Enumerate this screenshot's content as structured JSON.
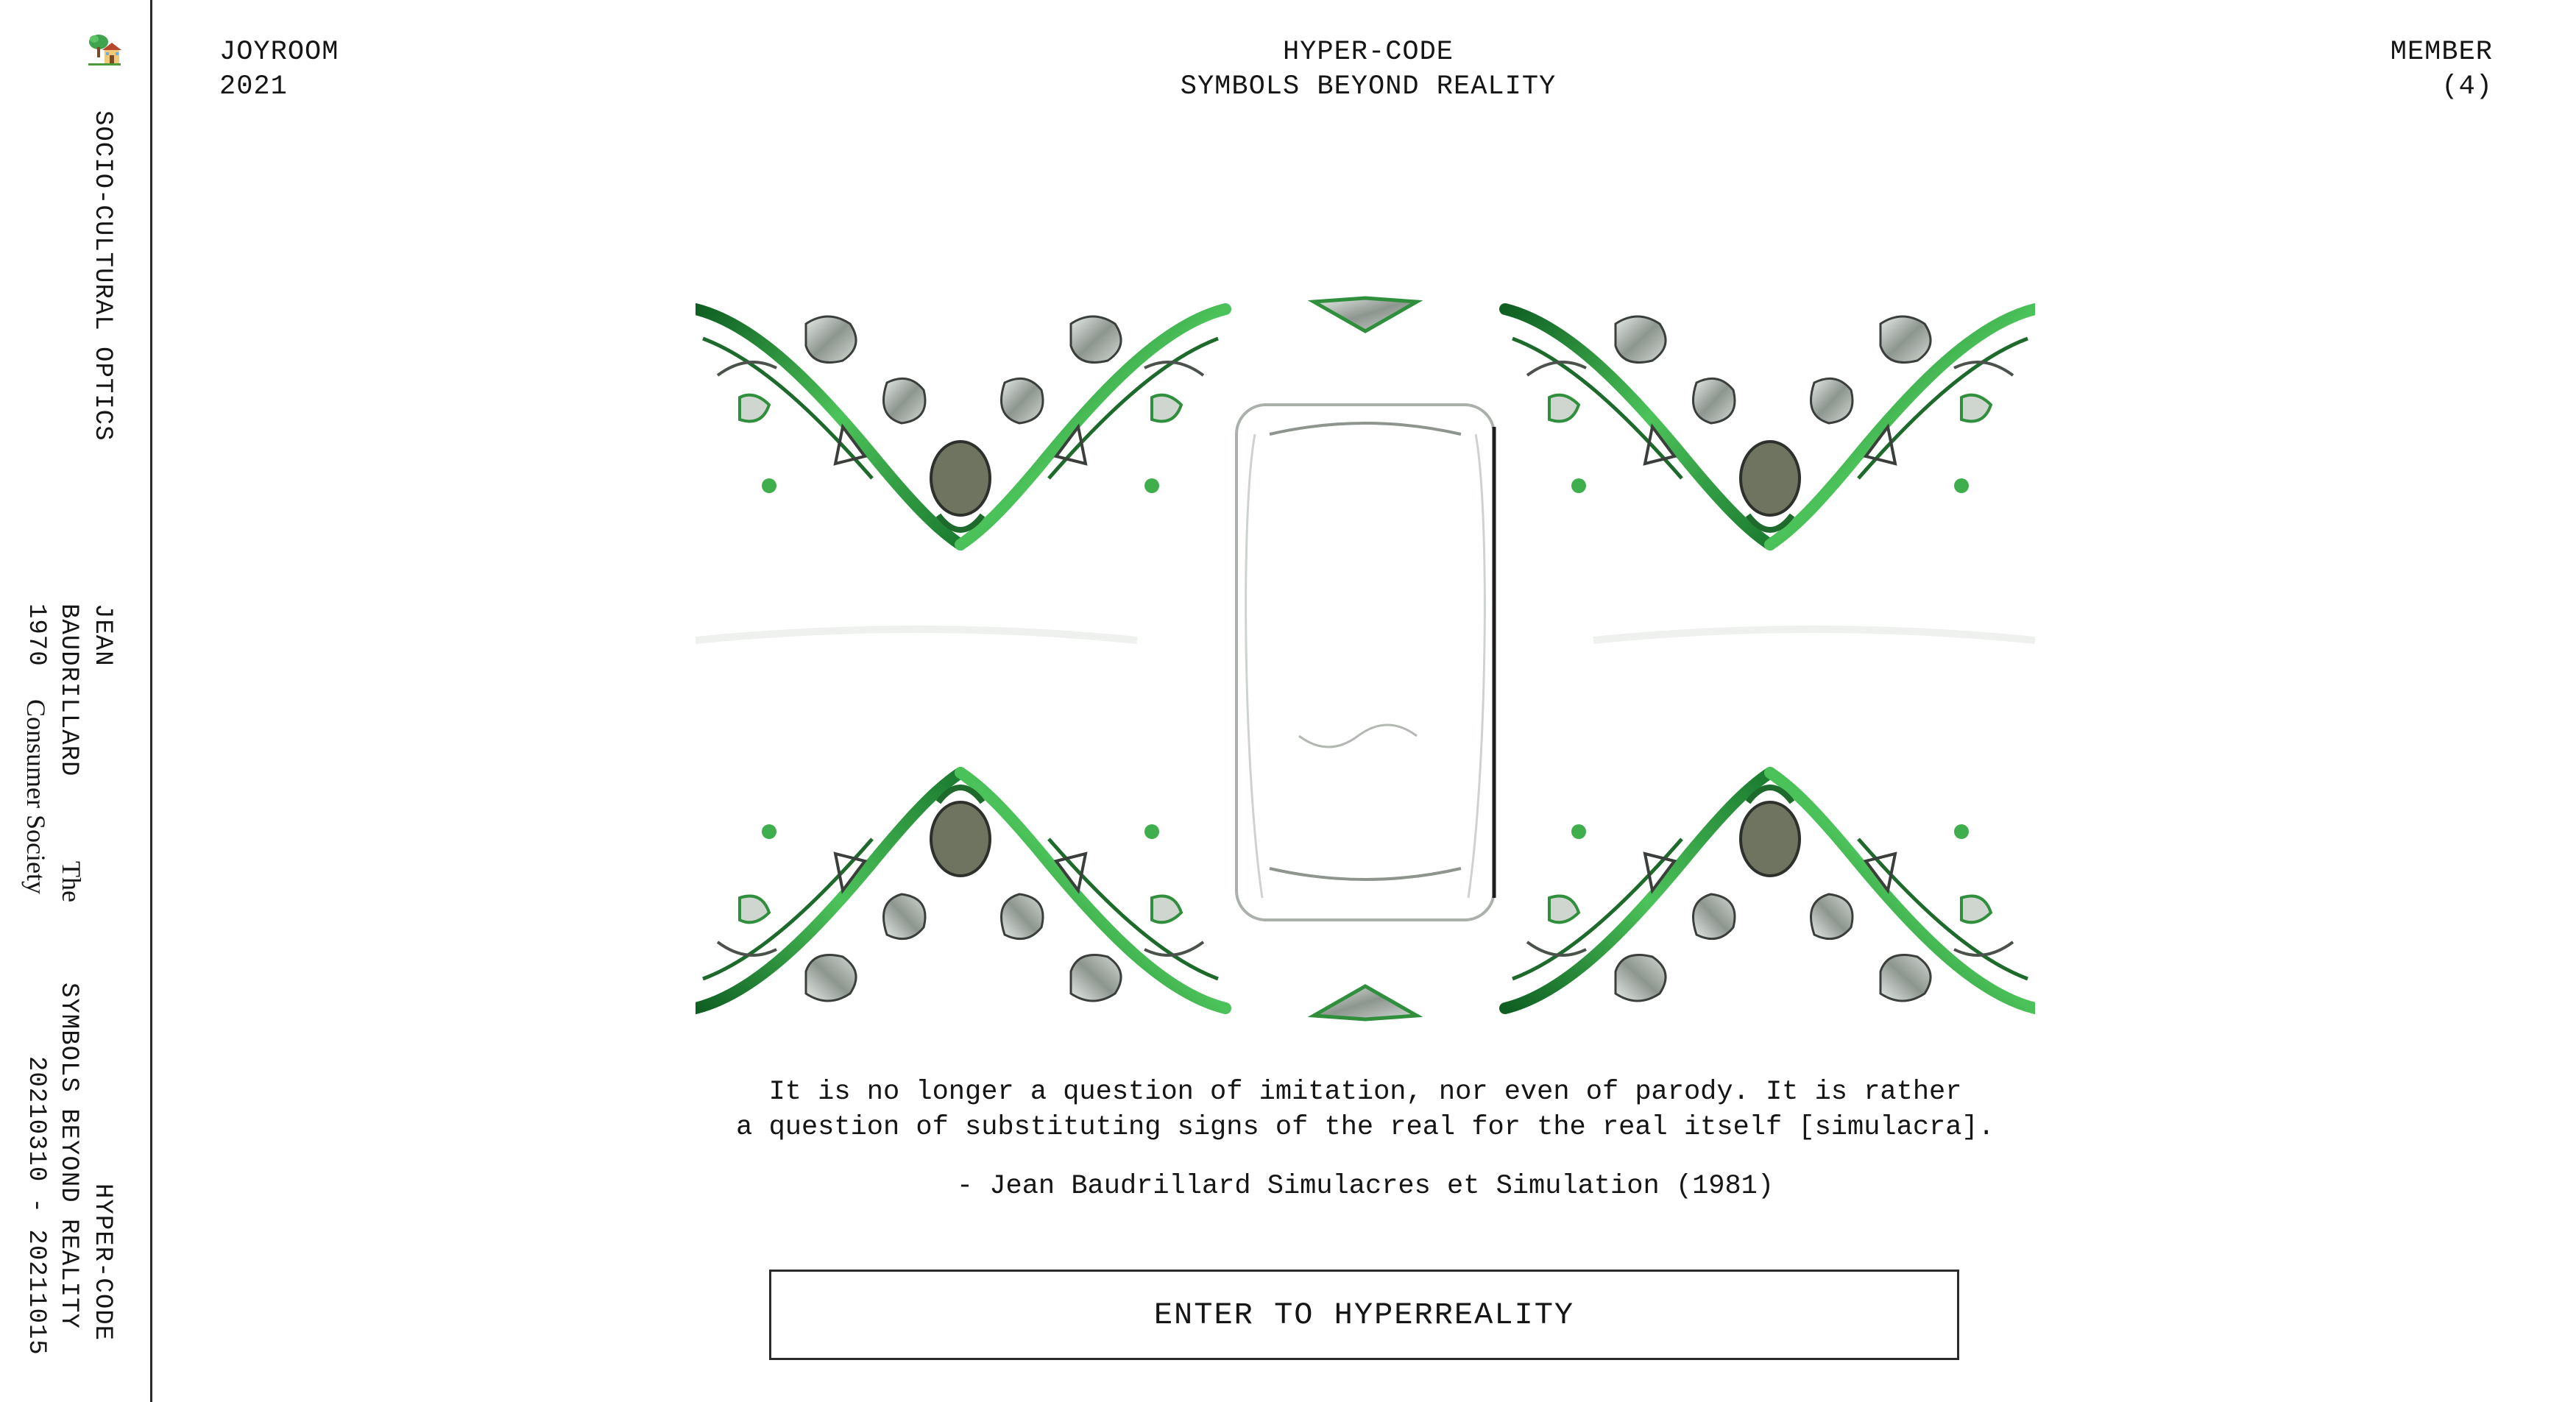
{
  "sidebar": {
    "logo_icon": "house-tree-icon",
    "section_title": "SOCIO-CULTURAL OPTICS",
    "author": {
      "first_name": "JEAN",
      "last_name": "BAUDRILLARD",
      "book_title": "The",
      "year": "1970",
      "book_subtitle": "Consumer Society"
    },
    "exhibition": {
      "title": "HYPER-CODE",
      "subtitle": "SYMBOLS BEYOND REALITY",
      "dates": "20210310 - 20211015"
    }
  },
  "header": {
    "left": {
      "brand": "JOYROOM",
      "year": "2021"
    },
    "center": {
      "title": "HYPER-CODE",
      "subtitle": "SYMBOLS BEYOND REALITY"
    },
    "right": {
      "label": "MEMBER",
      "count": "(4)"
    }
  },
  "artwork": {
    "description_icon": "chrome-symmetric-artwork",
    "accent_color": "#2e8b3d"
  },
  "quote": {
    "line1": "It is no longer a question of imitation, nor even of parody. It is rather",
    "line2": "a question of substituting signs of the real for the real itself [simulacra].",
    "attribution": "- Jean Baudrillard Simulacres et Simulation (1981)"
  },
  "cta": {
    "label": "ENTER TO HYPERREALITY"
  }
}
